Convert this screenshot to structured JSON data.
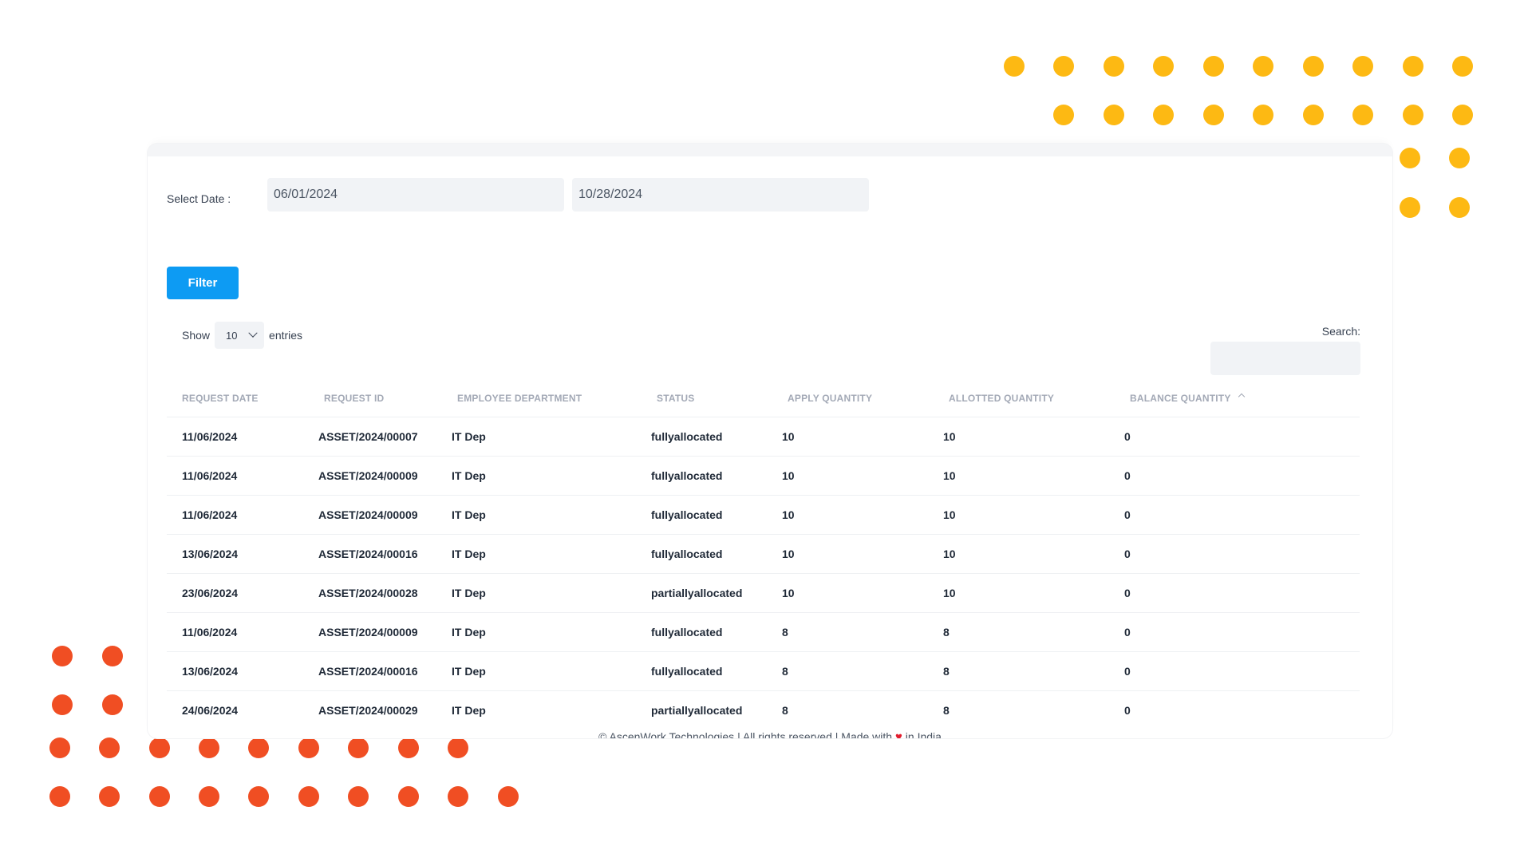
{
  "filters": {
    "select_date_label": "Select Date :",
    "date_from": "06/01/2024",
    "date_to": "10/28/2024",
    "filter_button": "Filter"
  },
  "table_controls": {
    "show_label": "Show",
    "entries_value": "10",
    "entries_label": "entries",
    "search_label": "Search:"
  },
  "table": {
    "columns": [
      "REQUEST DATE",
      "REQUEST ID",
      "EMPLOYEE DEPARTMENT",
      "STATUS",
      "APPLY QUANTITY",
      "ALLOTTED QUANTITY",
      "BALANCE QUANTITY"
    ],
    "rows": [
      [
        "11/06/2024",
        "ASSET/2024/00007",
        "IT Dep",
        "fullyallocated",
        "10",
        "10",
        "0"
      ],
      [
        "11/06/2024",
        "ASSET/2024/00009",
        "IT Dep",
        "fullyallocated",
        "10",
        "10",
        "0"
      ],
      [
        "11/06/2024",
        "ASSET/2024/00009",
        "IT Dep",
        "fullyallocated",
        "10",
        "10",
        "0"
      ],
      [
        "13/06/2024",
        "ASSET/2024/00016",
        "IT Dep",
        "fullyallocated",
        "10",
        "10",
        "0"
      ],
      [
        "23/06/2024",
        "ASSET/2024/00028",
        "IT Dep",
        "partiallyallocated",
        "10",
        "10",
        "0"
      ],
      [
        "11/06/2024",
        "ASSET/2024/00009",
        "IT Dep",
        "fullyallocated",
        "8",
        "8",
        "0"
      ],
      [
        "13/06/2024",
        "ASSET/2024/00016",
        "IT Dep",
        "fullyallocated",
        "8",
        "8",
        "0"
      ],
      [
        "24/06/2024",
        "ASSET/2024/00029",
        "IT Dep",
        "partiallyallocated",
        "8",
        "8",
        "0"
      ]
    ]
  },
  "footer": {
    "text_before": "© AscenWork Technologies | All rights reserved | Made with ",
    "text_after": " in India",
    "heart_icon": "heart-icon"
  },
  "colors": {
    "accent_button": "#0d9bf3",
    "dots_yellow": "#fdb913",
    "dots_red": "#f04e23",
    "heart": "#e11d2e"
  }
}
